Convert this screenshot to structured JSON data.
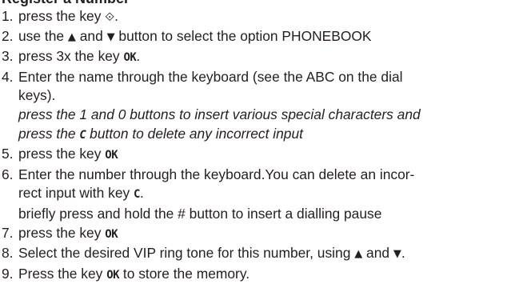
{
  "heading": "Register a Number",
  "icons": {
    "menu_key": "⟐",
    "up_arrow": "▲",
    "down_arrow": "▼"
  },
  "steps": [
    {
      "number": "1.",
      "parts": [
        "press the key ",
        "."
      ]
    },
    {
      "number": "2.",
      "parts": [
        "use the ",
        " and ",
        " button to select the option PHONEBOOK"
      ]
    },
    {
      "number": "3.",
      "parts": [
        "press 3x the key ",
        "OK",
        "."
      ]
    },
    {
      "number": "4.",
      "line1": "Enter the name through the keyboard (see the ABC on the dial",
      "line2": "keys).",
      "italic_line1": "press the 1 and 0 buttons to insert various special characters and",
      "italic_line2_parts": [
        "press the ",
        "C",
        " button to delete any incorrect input"
      ]
    },
    {
      "number": "5.",
      "parts": [
        "press the key ",
        "OK"
      ]
    },
    {
      "number": "6.",
      "line1": "Enter the number through the keyboard.You can delete an incor-",
      "line2_parts": [
        "rect input with key ",
        "C",
        "."
      ],
      "line3": "briefly press and hold the # button to insert a dialling pause"
    },
    {
      "number": "7.",
      "parts": [
        "press the key ",
        "OK"
      ]
    },
    {
      "number": "8.",
      "parts": [
        "Select the desired VIP ring tone for this number, using ",
        " and ",
        "."
      ]
    },
    {
      "number": "9.",
      "parts": [
        "Press the key ",
        "OK",
        " to store the memory."
      ]
    }
  ]
}
